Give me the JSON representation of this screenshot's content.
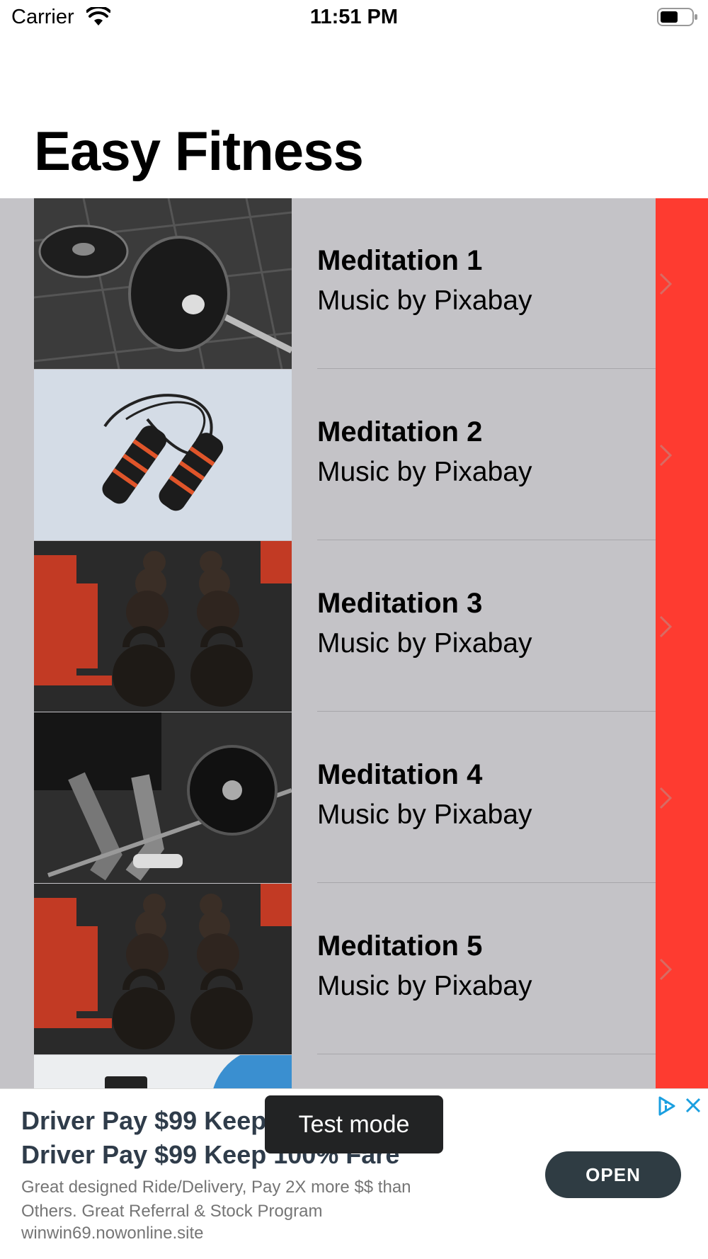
{
  "status_bar": {
    "carrier": "Carrier",
    "time": "11:51 PM"
  },
  "page": {
    "title": "Easy Fitness"
  },
  "list": {
    "items": [
      {
        "title": "Meditation 1",
        "subtitle": "Music by Pixabay",
        "image": "barbell-plates-photo"
      },
      {
        "title": "Meditation 2",
        "subtitle": "Music by Pixabay",
        "image": "jump-rope-photo"
      },
      {
        "title": "Meditation 3",
        "subtitle": "Music by Pixabay",
        "image": "kettlebells-photo"
      },
      {
        "title": "Meditation 4",
        "subtitle": "Music by Pixabay",
        "image": "deadlift-photo"
      },
      {
        "title": "Meditation 5",
        "subtitle": "Music by Pixabay",
        "image": "kettlebells-photo"
      },
      {
        "title": "",
        "subtitle": "",
        "image": "gym-ball-photo"
      }
    ]
  },
  "ad": {
    "headline_1": "Driver Pay $99 Keep 100% Fare",
    "headline_2": "Driver Pay $99 Keep 100% Fare",
    "body": "Great designed Ride/Delivery, Pay 2X more $$ than Others. Great Referral & Stock Program",
    "domain": "winwin69.nowonline.site",
    "cta": "OPEN",
    "badge": "Test mode",
    "icons": [
      "adchoices-icon",
      "close-icon"
    ]
  },
  "colors": {
    "accent_red": "#fe3b30",
    "list_bg": "#c4c3c7",
    "ad_button": "#2f3c43"
  }
}
